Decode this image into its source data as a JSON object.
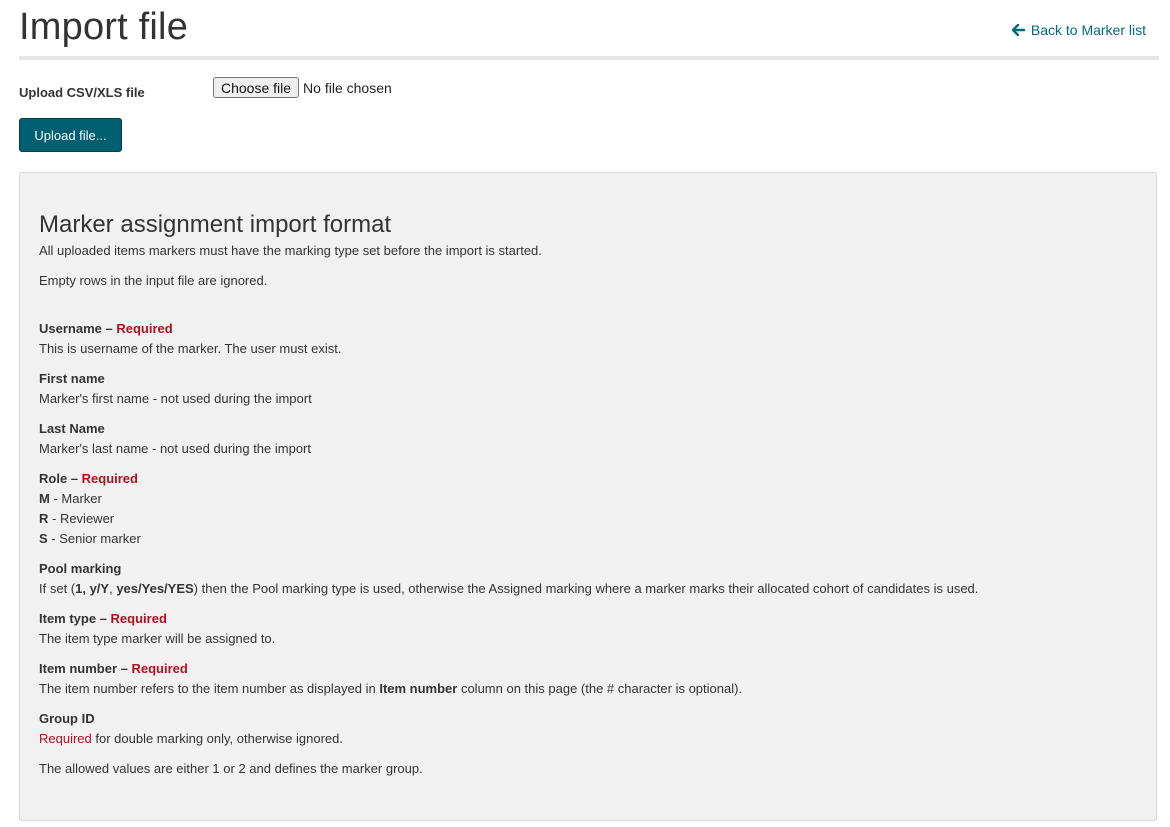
{
  "header": {
    "title": "Import file",
    "back_link": "Back to Marker list"
  },
  "upload": {
    "label": "Upload CSV/XLS file",
    "choose_button": "Choose file",
    "no_file_text": "No file chosen",
    "submit_button": "Upload file..."
  },
  "format": {
    "title": "Marker assignment import format",
    "intro1": "All uploaded items markers must have the marking type set before the import is started.",
    "intro2": "Empty rows in the input file are ignored.",
    "required_label": "Required",
    "dash": " – ",
    "username": {
      "name": "Username",
      "desc": "This is username of the marker. The user must exist."
    },
    "first_name": {
      "name": "First name",
      "desc": "Marker's first name - not used during the import"
    },
    "last_name": {
      "name": "Last Name",
      "desc": "Marker's last name - not used during the import"
    },
    "role": {
      "name": "Role",
      "options": [
        {
          "code": "M",
          "text": " - Marker"
        },
        {
          "code": "R",
          "text": " - Reviewer"
        },
        {
          "code": "S",
          "text": " - Senior marker"
        }
      ]
    },
    "pool_marking": {
      "name": "Pool marking",
      "desc_pre": "If set (",
      "values1": "1, y/Y",
      "comma": ", ",
      "values2": "yes/Yes/YES",
      "desc_post": ") then the Pool marking type is used, otherwise the Assigned marking where a marker marks their allocated cohort of candidates is used."
    },
    "item_type": {
      "name": "Item type",
      "desc": "The item type marker will be assigned to."
    },
    "item_number": {
      "name": "Item number",
      "desc_pre": "The item number refers to the item number as displayed in ",
      "desc_bold": "Item number",
      "desc_post": " column on this page (the # character is optional)."
    },
    "group_id": {
      "name": "Group ID",
      "required_text": "Required",
      "desc": " for double marking only, otherwise ignored.",
      "allowed": "The allowed values are either 1 or 2 and defines the marker group."
    }
  },
  "colors": {
    "accent": "#006a7d",
    "button_bg": "#005f70",
    "required": "#b30f1f",
    "panel_bg": "#f2f1f2"
  },
  "icons": {
    "back": "arrow-left-icon"
  }
}
